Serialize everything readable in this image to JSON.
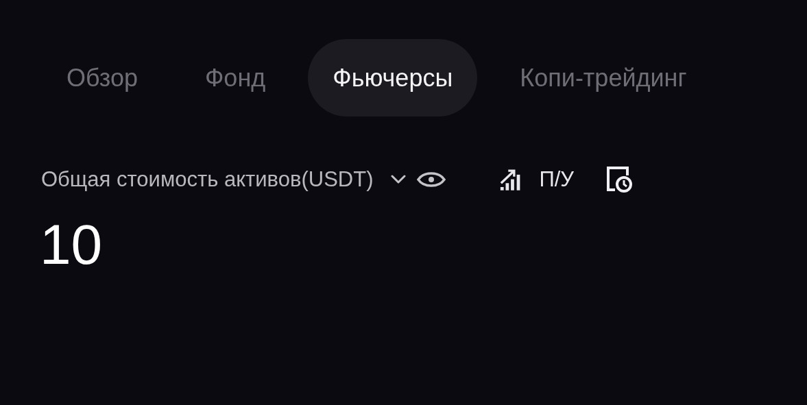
{
  "tabs": [
    {
      "label": "Обзор",
      "selected": false
    },
    {
      "label": "Фонд",
      "selected": false
    },
    {
      "label": "Фьючерсы",
      "selected": true
    },
    {
      "label": "Копи-трейдинг",
      "selected": false
    }
  ],
  "balance": {
    "label": "Общая стоимость активов(USDT)",
    "value": "10",
    "pnl_label": "П/У"
  }
}
